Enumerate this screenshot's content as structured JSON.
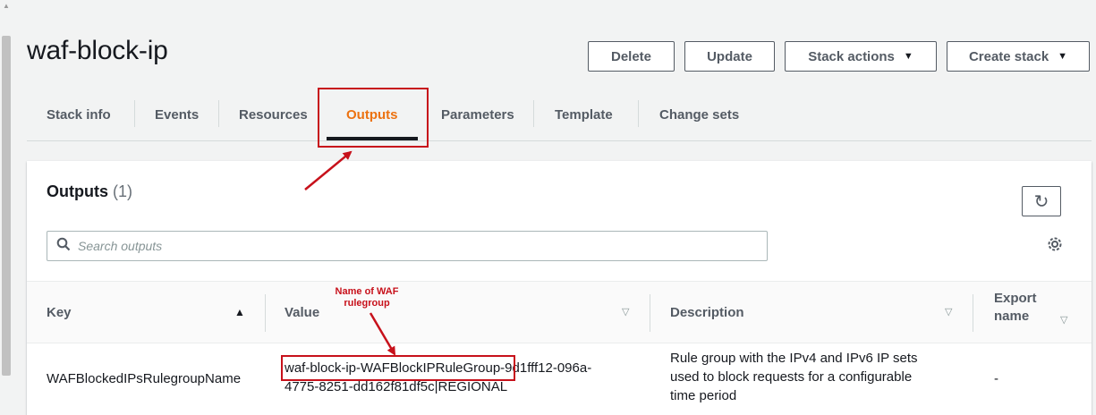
{
  "page": {
    "title": "waf-block-ip"
  },
  "header_buttons": {
    "delete": "Delete",
    "update": "Update",
    "stack_actions": "Stack actions",
    "create_stack": "Create stack"
  },
  "tabs": [
    {
      "label": "Stack info"
    },
    {
      "label": "Events"
    },
    {
      "label": "Resources"
    },
    {
      "label": "Outputs",
      "active": true
    },
    {
      "label": "Parameters"
    },
    {
      "label": "Template"
    },
    {
      "label": "Change sets"
    }
  ],
  "outputs": {
    "title": "Outputs",
    "count": "(1)",
    "search_placeholder": "Search outputs",
    "columns": {
      "key": "Key",
      "value": "Value",
      "description": "Description",
      "export_name_line1": "Export",
      "export_name_line2": "name"
    },
    "rows": [
      {
        "key": "WAFBlockedIPsRulegroupName",
        "value_line1": "waf-block-ip-WAFBlockIPRuleGroup-9d1fff12-096a-",
        "value_line2": "4775-8251-dd162f81df5c|REGIONAL",
        "description_line1": "Rule group with the IPv4 and IPv6 IP sets",
        "description_line2": "used to block requests for a configurable",
        "description_line3": "time period",
        "export_name": "-"
      }
    ]
  },
  "annotation": {
    "label_line1": "Name of WAF",
    "label_line2": "rulegroup"
  },
  "colors": {
    "accent": "#ec7211",
    "annotation": "#c7111b",
    "text": "#16191f",
    "muted": "#545b64"
  }
}
